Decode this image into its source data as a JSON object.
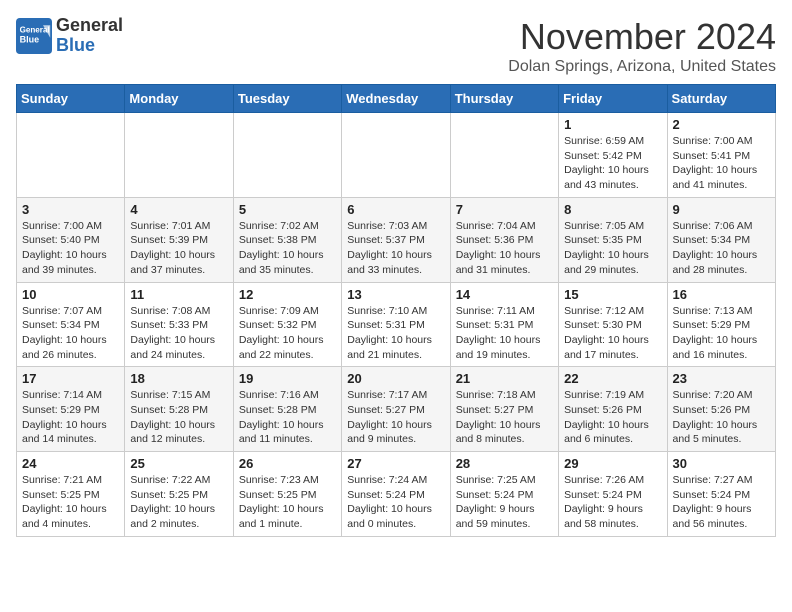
{
  "header": {
    "logo_general": "General",
    "logo_blue": "Blue",
    "month": "November 2024",
    "location": "Dolan Springs, Arizona, United States"
  },
  "days_of_week": [
    "Sunday",
    "Monday",
    "Tuesday",
    "Wednesday",
    "Thursday",
    "Friday",
    "Saturday"
  ],
  "weeks": [
    [
      {
        "day": "",
        "info": ""
      },
      {
        "day": "",
        "info": ""
      },
      {
        "day": "",
        "info": ""
      },
      {
        "day": "",
        "info": ""
      },
      {
        "day": "",
        "info": ""
      },
      {
        "day": "1",
        "info": "Sunrise: 6:59 AM\nSunset: 5:42 PM\nDaylight: 10 hours and 43 minutes."
      },
      {
        "day": "2",
        "info": "Sunrise: 7:00 AM\nSunset: 5:41 PM\nDaylight: 10 hours and 41 minutes."
      }
    ],
    [
      {
        "day": "3",
        "info": "Sunrise: 7:00 AM\nSunset: 5:40 PM\nDaylight: 10 hours and 39 minutes."
      },
      {
        "day": "4",
        "info": "Sunrise: 7:01 AM\nSunset: 5:39 PM\nDaylight: 10 hours and 37 minutes."
      },
      {
        "day": "5",
        "info": "Sunrise: 7:02 AM\nSunset: 5:38 PM\nDaylight: 10 hours and 35 minutes."
      },
      {
        "day": "6",
        "info": "Sunrise: 7:03 AM\nSunset: 5:37 PM\nDaylight: 10 hours and 33 minutes."
      },
      {
        "day": "7",
        "info": "Sunrise: 7:04 AM\nSunset: 5:36 PM\nDaylight: 10 hours and 31 minutes."
      },
      {
        "day": "8",
        "info": "Sunrise: 7:05 AM\nSunset: 5:35 PM\nDaylight: 10 hours and 29 minutes."
      },
      {
        "day": "9",
        "info": "Sunrise: 7:06 AM\nSunset: 5:34 PM\nDaylight: 10 hours and 28 minutes."
      }
    ],
    [
      {
        "day": "10",
        "info": "Sunrise: 7:07 AM\nSunset: 5:34 PM\nDaylight: 10 hours and 26 minutes."
      },
      {
        "day": "11",
        "info": "Sunrise: 7:08 AM\nSunset: 5:33 PM\nDaylight: 10 hours and 24 minutes."
      },
      {
        "day": "12",
        "info": "Sunrise: 7:09 AM\nSunset: 5:32 PM\nDaylight: 10 hours and 22 minutes."
      },
      {
        "day": "13",
        "info": "Sunrise: 7:10 AM\nSunset: 5:31 PM\nDaylight: 10 hours and 21 minutes."
      },
      {
        "day": "14",
        "info": "Sunrise: 7:11 AM\nSunset: 5:31 PM\nDaylight: 10 hours and 19 minutes."
      },
      {
        "day": "15",
        "info": "Sunrise: 7:12 AM\nSunset: 5:30 PM\nDaylight: 10 hours and 17 minutes."
      },
      {
        "day": "16",
        "info": "Sunrise: 7:13 AM\nSunset: 5:29 PM\nDaylight: 10 hours and 16 minutes."
      }
    ],
    [
      {
        "day": "17",
        "info": "Sunrise: 7:14 AM\nSunset: 5:29 PM\nDaylight: 10 hours and 14 minutes."
      },
      {
        "day": "18",
        "info": "Sunrise: 7:15 AM\nSunset: 5:28 PM\nDaylight: 10 hours and 12 minutes."
      },
      {
        "day": "19",
        "info": "Sunrise: 7:16 AM\nSunset: 5:28 PM\nDaylight: 10 hours and 11 minutes."
      },
      {
        "day": "20",
        "info": "Sunrise: 7:17 AM\nSunset: 5:27 PM\nDaylight: 10 hours and 9 minutes."
      },
      {
        "day": "21",
        "info": "Sunrise: 7:18 AM\nSunset: 5:27 PM\nDaylight: 10 hours and 8 minutes."
      },
      {
        "day": "22",
        "info": "Sunrise: 7:19 AM\nSunset: 5:26 PM\nDaylight: 10 hours and 6 minutes."
      },
      {
        "day": "23",
        "info": "Sunrise: 7:20 AM\nSunset: 5:26 PM\nDaylight: 10 hours and 5 minutes."
      }
    ],
    [
      {
        "day": "24",
        "info": "Sunrise: 7:21 AM\nSunset: 5:25 PM\nDaylight: 10 hours and 4 minutes."
      },
      {
        "day": "25",
        "info": "Sunrise: 7:22 AM\nSunset: 5:25 PM\nDaylight: 10 hours and 2 minutes."
      },
      {
        "day": "26",
        "info": "Sunrise: 7:23 AM\nSunset: 5:25 PM\nDaylight: 10 hours and 1 minute."
      },
      {
        "day": "27",
        "info": "Sunrise: 7:24 AM\nSunset: 5:24 PM\nDaylight: 10 hours and 0 minutes."
      },
      {
        "day": "28",
        "info": "Sunrise: 7:25 AM\nSunset: 5:24 PM\nDaylight: 9 hours and 59 minutes."
      },
      {
        "day": "29",
        "info": "Sunrise: 7:26 AM\nSunset: 5:24 PM\nDaylight: 9 hours and 58 minutes."
      },
      {
        "day": "30",
        "info": "Sunrise: 7:27 AM\nSunset: 5:24 PM\nDaylight: 9 hours and 56 minutes."
      }
    ]
  ]
}
